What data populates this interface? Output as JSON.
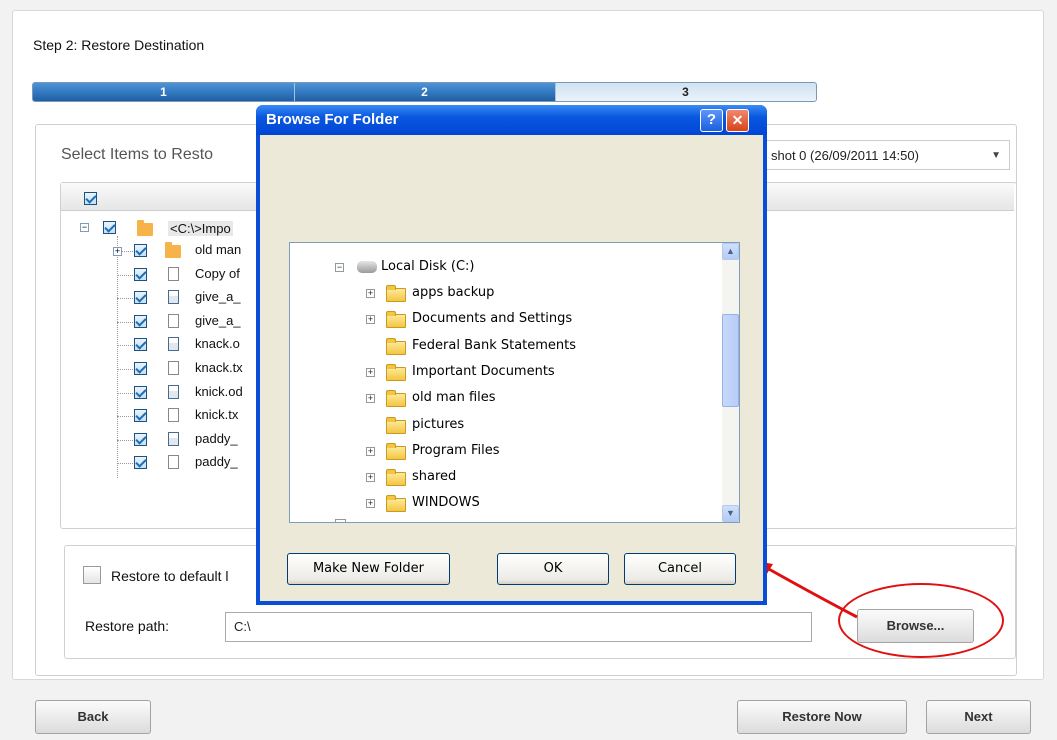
{
  "step_title": "Step 2: Restore Destination",
  "progress": {
    "steps": [
      "1",
      "2",
      "3"
    ],
    "current": 2,
    "fill_fraction": 0.667
  },
  "select_label": "Select Items to Resto",
  "snapshot_select": "shot 0 (26/09/2011 14:50)",
  "tree": {
    "root_label": "<C:\\>Impo",
    "items": [
      {
        "label": "old man",
        "icon": "folder-icon",
        "expander": "+"
      },
      {
        "label": "Copy of",
        "icon": "txt-file-icon"
      },
      {
        "label": "give_a_",
        "icon": "odt-file-icon"
      },
      {
        "label": "give_a_",
        "icon": "txt-file-icon"
      },
      {
        "label": "knack.o",
        "icon": "odt-file-icon"
      },
      {
        "label": "knack.tx",
        "icon": "txt-file-icon"
      },
      {
        "label": "knick.od",
        "icon": "odt-file-icon"
      },
      {
        "label": "knick.tx",
        "icon": "txt-file-icon"
      },
      {
        "label": "paddy_",
        "icon": "odt-file-icon"
      },
      {
        "label": "paddy_",
        "icon": "txt-file-icon"
      }
    ]
  },
  "restore_default_label": "Restore to default l",
  "restore_path_label": "Restore path:",
  "restore_path_value": "C:\\",
  "browse_button": "Browse...",
  "back_button": "Back",
  "restore_now_button": "Restore Now",
  "next_button": "Next",
  "dialog": {
    "title": "Browse For Folder",
    "help_button": "?",
    "close_button": "✕",
    "root": {
      "label": "Local Disk (C:)",
      "expander": "−"
    },
    "folders": [
      {
        "label": "apps backup",
        "expander": "+"
      },
      {
        "label": "Documents and Settings",
        "expander": "+"
      },
      {
        "label": "Federal Bank Statements",
        "expander": ""
      },
      {
        "label": "Important Documents",
        "expander": "+"
      },
      {
        "label": "old man files",
        "expander": "+"
      },
      {
        "label": "pictures",
        "expander": ""
      },
      {
        "label": "Program Files",
        "expander": "+"
      },
      {
        "label": "shared",
        "expander": "+"
      },
      {
        "label": "WINDOWS",
        "expander": "+"
      }
    ],
    "make_new_folder": "Make New Folder",
    "ok": "OK",
    "cancel": "Cancel"
  },
  "colors": {
    "accent_blue": "#2f74bb",
    "xp_title_blue": "#0a57e0",
    "callout_red": "#e01010"
  }
}
